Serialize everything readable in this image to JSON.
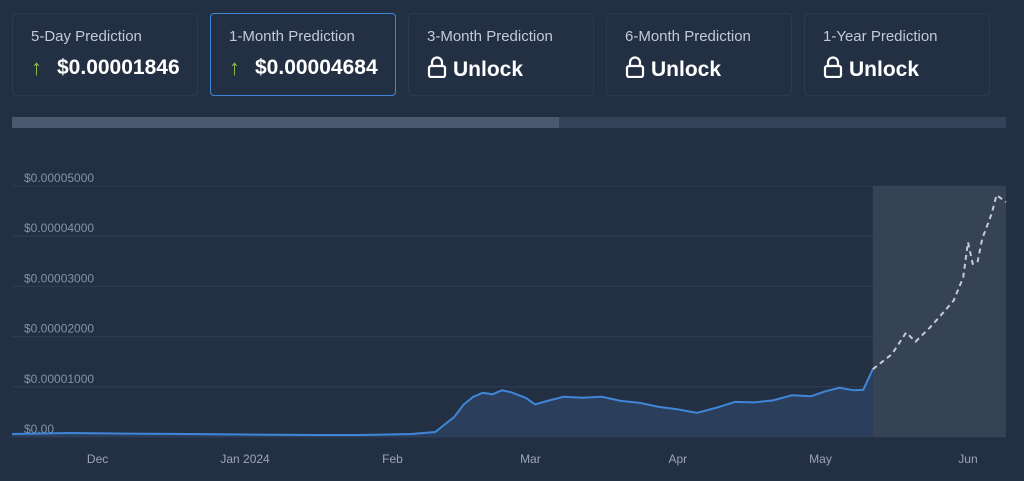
{
  "cards": [
    {
      "label": "5-Day Prediction",
      "value": "$0.00001846",
      "icon": "arrow-up-icon",
      "active": false
    },
    {
      "label": "1-Month Prediction",
      "value": "$0.00004684",
      "icon": "arrow-up-icon",
      "active": true
    },
    {
      "label": "3-Month Prediction",
      "value": "Unlock",
      "icon": "lock-icon",
      "active": false
    },
    {
      "label": "6-Month Prediction",
      "value": "Unlock",
      "icon": "lock-icon",
      "active": false
    },
    {
      "label": "1-Year Prediction",
      "value": "Unlock",
      "icon": "lock-icon",
      "active": false
    }
  ],
  "range_selector": {
    "selected_fraction": 0.55
  },
  "colors": {
    "background": "#233044",
    "history_line": "#3f86d8",
    "prediction_line": "#c8ccd2",
    "up_arrow": "#8bc34a"
  },
  "chart_data": {
    "type": "line",
    "title": "",
    "xlabel": "",
    "ylabel": "",
    "x_ticks": [
      "Dec",
      "Jan 2024",
      "Feb",
      "Mar",
      "Apr",
      "May",
      "Jun"
    ],
    "y_ticks": [
      "$0.00",
      "$0.00001000",
      "$0.00002000",
      "$0.00003000",
      "$0.00004000",
      "$0.00005000"
    ],
    "ylim": [
      0,
      5e-05
    ],
    "xlim": [
      "2023-11-13",
      "2024-06-09"
    ],
    "grid": true,
    "series": [
      {
        "style": "solid",
        "x": [
          "2023-11-13",
          "2023-11-25",
          "2023-12-05",
          "2023-12-20",
          "2024-01-01",
          "2024-01-15",
          "2024-01-25",
          "2024-02-05",
          "2024-02-10",
          "2024-02-12",
          "2024-02-14",
          "2024-02-16",
          "2024-02-18",
          "2024-02-20",
          "2024-02-22",
          "2024-02-24",
          "2024-02-26",
          "2024-02-29",
          "2024-03-02",
          "2024-03-05",
          "2024-03-08",
          "2024-03-12",
          "2024-03-16",
          "2024-03-20",
          "2024-03-24",
          "2024-03-28",
          "2024-04-01",
          "2024-04-05",
          "2024-04-09",
          "2024-04-13",
          "2024-04-17",
          "2024-04-21",
          "2024-04-25",
          "2024-04-29",
          "2024-05-02",
          "2024-05-05",
          "2024-05-08",
          "2024-05-10",
          "2024-05-12"
        ],
        "y": [
          6e-07,
          8e-07,
          7e-07,
          6e-07,
          5e-07,
          4e-07,
          4e-07,
          6e-07,
          1e-06,
          2.5e-06,
          4e-06,
          6.5e-06,
          8e-06,
          8.8e-06,
          8.5e-06,
          9.3e-06,
          8.9e-06,
          7.8e-06,
          6.5e-06,
          7.3e-06,
          8e-06,
          7.8e-06,
          8e-06,
          7.2e-06,
          6.8e-06,
          6e-06,
          5.5e-06,
          4.8e-06,
          5.8e-06,
          7e-06,
          6.9e-06,
          7.3e-06,
          8.3e-06,
          8.1e-06,
          9.1e-06,
          9.8e-06,
          9.3e-06,
          9.4e-06,
          1.35e-05
        ]
      },
      {
        "style": "dashed",
        "x": [
          "2024-05-12",
          "2024-05-16",
          "2024-05-19",
          "2024-05-21",
          "2024-05-24",
          "2024-05-27",
          "2024-05-29",
          "2024-05-31",
          "2024-06-01",
          "2024-06-02",
          "2024-06-03",
          "2024-06-04",
          "2024-06-06",
          "2024-06-07",
          "2024-06-09"
        ],
        "y": [
          1.35e-05,
          1.65e-05,
          2.08e-05,
          1.9e-05,
          2.18e-05,
          2.5e-05,
          2.72e-05,
          3.18e-05,
          3.88e-05,
          3.45e-05,
          3.48e-05,
          3.95e-05,
          4.45e-05,
          4.82e-05,
          4.68e-05
        ]
      }
    ]
  }
}
